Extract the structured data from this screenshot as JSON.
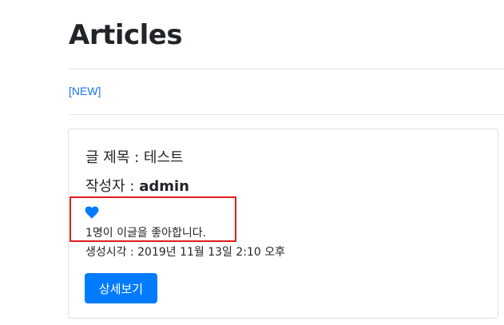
{
  "header": {
    "title": "Articles"
  },
  "nav": {
    "new_link": "[NEW]"
  },
  "article": {
    "title_label": "글 제목 : ",
    "title_value": "테스트",
    "author_label": "작성자 : ",
    "author_value": "admin",
    "like_icon": "heart-icon",
    "like_icon_color": "#007bff",
    "likes_text": "1명이 이글을 좋아합니다.",
    "created_text": "생성시각 : 2019년 11월 13일 2:10 오후",
    "detail_button_label": "상세보기"
  },
  "colors": {
    "accent": "#007bff",
    "highlight": "#e01c1c",
    "link": "#1a73e8"
  }
}
